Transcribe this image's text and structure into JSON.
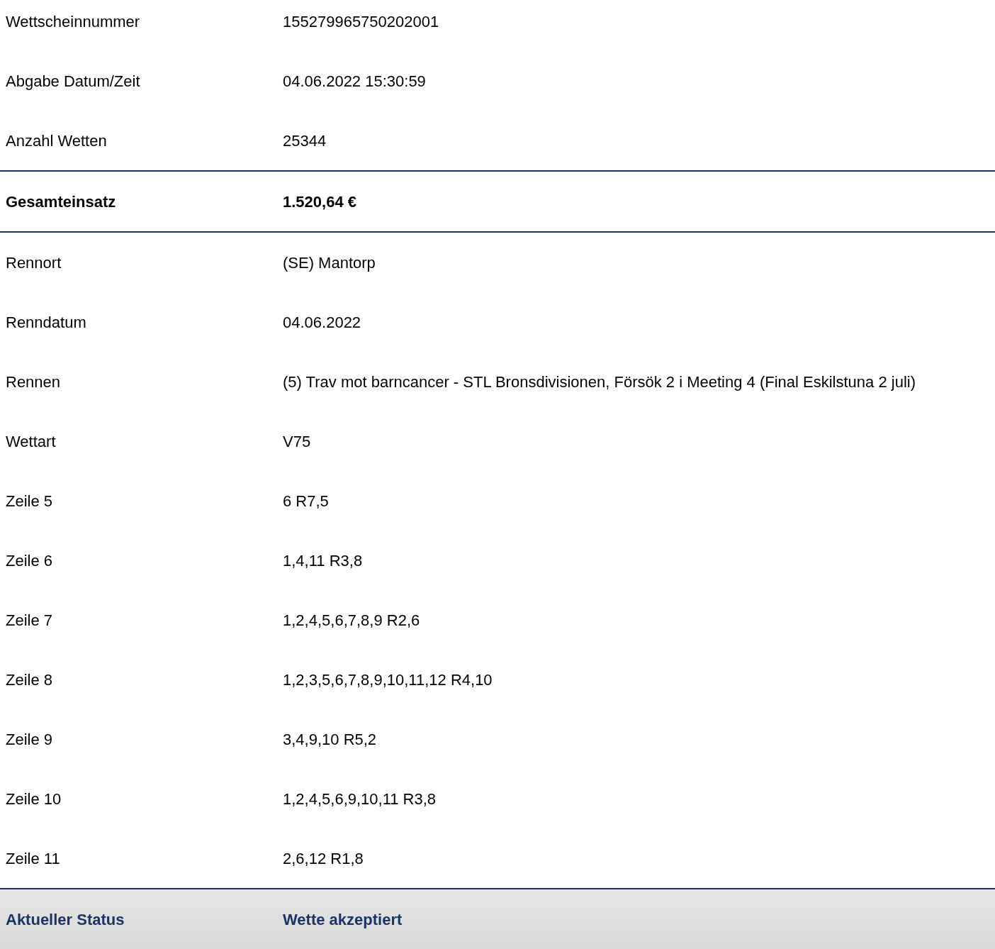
{
  "sections": [
    {
      "kind": "details",
      "rows": [
        {
          "label": "Wettscheinnummer",
          "value": "155279965750202001"
        },
        {
          "label": "Abgabe Datum/Zeit",
          "value": "04.06.2022 15:30:59"
        },
        {
          "label": "Anzahl Wetten",
          "value": "25344"
        }
      ]
    },
    {
      "kind": "total",
      "rows": [
        {
          "label": "Gesamteinsatz",
          "value": "1.520,64 €"
        }
      ]
    },
    {
      "kind": "details",
      "rows": [
        {
          "label": "Rennort",
          "value": "(SE) Mantorp"
        },
        {
          "label": "Renndatum",
          "value": "04.06.2022"
        },
        {
          "label": "Rennen",
          "value": "(5) Trav mot barncancer - STL Bronsdivisionen, Försök 2 i Meeting 4 (Final Eskilstuna 2 juli)"
        },
        {
          "label": "Wettart",
          "value": "V75"
        },
        {
          "label": "Zeile 5",
          "value": "6 R7,5"
        },
        {
          "label": "Zeile 6",
          "value": "1,4,11 R3,8"
        },
        {
          "label": "Zeile 7",
          "value": "1,2,4,5,6,7,8,9 R2,6"
        },
        {
          "label": "Zeile 8",
          "value": "1,2,3,5,6,7,8,9,10,11,12 R4,10"
        },
        {
          "label": "Zeile 9",
          "value": "3,4,9,10 R5,2"
        },
        {
          "label": "Zeile 10",
          "value": "1,2,4,5,6,9,10,11 R3,8"
        },
        {
          "label": "Zeile 11",
          "value": "2,6,12 R1,8"
        }
      ]
    },
    {
      "kind": "status",
      "rows": [
        {
          "label": "Aktueller Status",
          "value": "Wette akzeptiert"
        }
      ]
    }
  ]
}
